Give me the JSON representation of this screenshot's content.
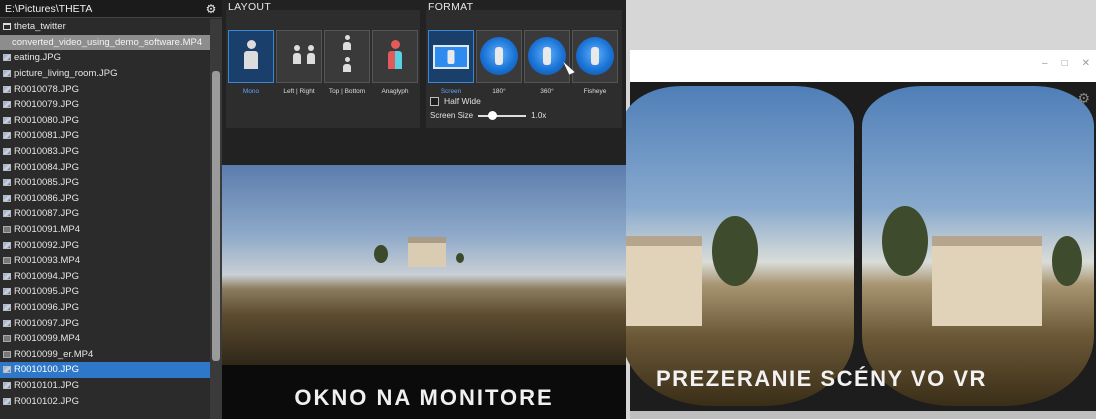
{
  "browser": {
    "path": "E:\\Pictures\\THETA",
    "files": [
      {
        "name": "theta_twitter",
        "type": "folder",
        "state": ""
      },
      {
        "name": "converted_video_using_demo_software.MP4",
        "type": "video",
        "state": "highlight"
      },
      {
        "name": "eating.JPG",
        "type": "image",
        "state": ""
      },
      {
        "name": "picture_living_room.JPG",
        "type": "image",
        "state": ""
      },
      {
        "name": "R0010078.JPG",
        "type": "image",
        "state": ""
      },
      {
        "name": "R0010079.JPG",
        "type": "image",
        "state": ""
      },
      {
        "name": "R0010080.JPG",
        "type": "image",
        "state": ""
      },
      {
        "name": "R0010081.JPG",
        "type": "image",
        "state": ""
      },
      {
        "name": "R0010083.JPG",
        "type": "image",
        "state": ""
      },
      {
        "name": "R0010084.JPG",
        "type": "image",
        "state": ""
      },
      {
        "name": "R0010085.JPG",
        "type": "image",
        "state": ""
      },
      {
        "name": "R0010086.JPG",
        "type": "image",
        "state": ""
      },
      {
        "name": "R0010087.JPG",
        "type": "image",
        "state": ""
      },
      {
        "name": "R0010091.MP4",
        "type": "video",
        "state": ""
      },
      {
        "name": "R0010092.JPG",
        "type": "image",
        "state": ""
      },
      {
        "name": "R0010093.MP4",
        "type": "video",
        "state": ""
      },
      {
        "name": "R0010094.JPG",
        "type": "image",
        "state": ""
      },
      {
        "name": "R0010095.JPG",
        "type": "image",
        "state": ""
      },
      {
        "name": "R0010096.JPG",
        "type": "image",
        "state": ""
      },
      {
        "name": "R0010097.JPG",
        "type": "image",
        "state": ""
      },
      {
        "name": "R0010099.MP4",
        "type": "video",
        "state": ""
      },
      {
        "name": "R0010099_er.MP4",
        "type": "video",
        "state": ""
      },
      {
        "name": "R0010100.JPG",
        "type": "image",
        "state": "selected"
      },
      {
        "name": "R0010101.JPG",
        "type": "image",
        "state": ""
      },
      {
        "name": "R0010102.JPG",
        "type": "image",
        "state": ""
      }
    ]
  },
  "layout": {
    "title": "LAYOUT",
    "options": [
      {
        "label": "Mono",
        "active": true
      },
      {
        "label": "Left | Right",
        "active": false
      },
      {
        "label": "Top | Bottom",
        "active": false
      },
      {
        "label": "Anaglyph",
        "active": false
      }
    ]
  },
  "format": {
    "title": "FORMAT",
    "options": [
      {
        "label": "Screen",
        "active": true
      },
      {
        "label": "180°",
        "active": false
      },
      {
        "label": "360°",
        "active": false
      },
      {
        "label": "Fisheye",
        "active": false
      }
    ],
    "half_wide_label": "Half Wide",
    "screen_size_label": "Screen Size",
    "screen_size_value": "1.0x"
  },
  "preview": {
    "caption": "OKNO NA MONITORE"
  },
  "vr": {
    "caption": "PREZERANIE SCÉNY VO VR",
    "window_buttons": [
      "–",
      "□",
      "✕"
    ]
  },
  "colors": {
    "accent": "#2f78c9",
    "highlight_row": "#8d8d8d",
    "panel_bg": "#2d2d2d"
  }
}
